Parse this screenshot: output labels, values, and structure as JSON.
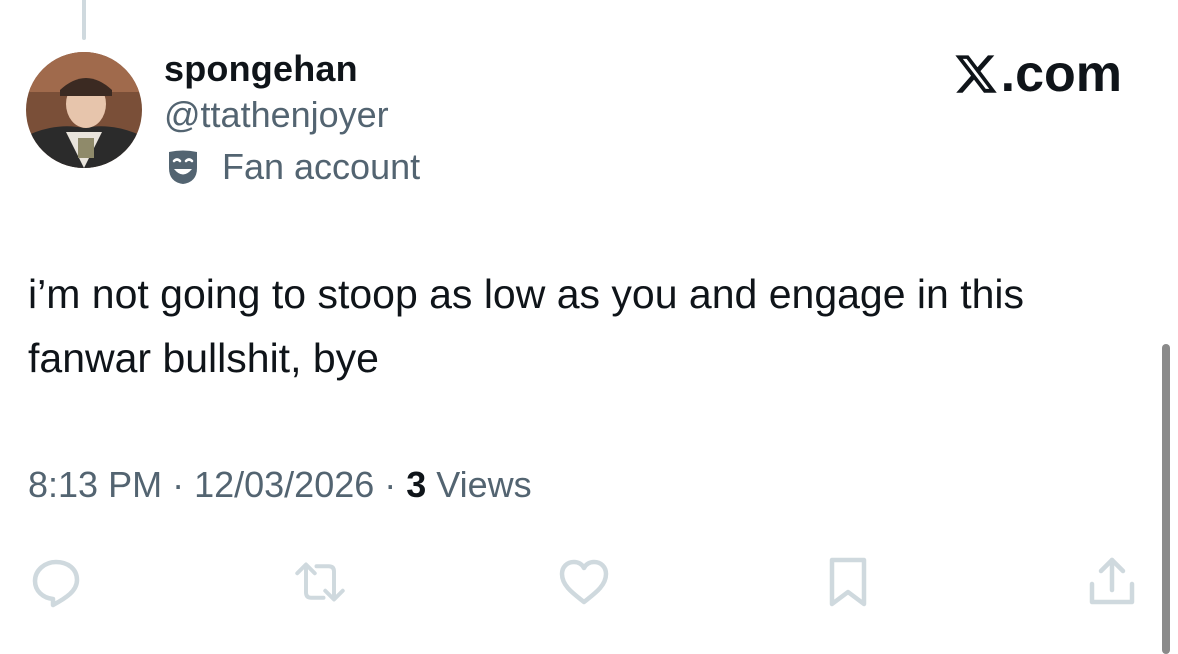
{
  "user": {
    "display_name": "spongehan",
    "handle": "@ttathenjoyer",
    "affiliation_label": "Fan account",
    "affiliation_icon": "theater-mask-icon",
    "avatar_icon": "avatar-photo"
  },
  "brand": {
    "text": ".com",
    "icon": "x-logo-icon"
  },
  "tweet": {
    "text": "i’m not going to stoop as low as you and engage in this fanwar bullshit, bye"
  },
  "meta": {
    "time": "8:13 PM",
    "separator_1": " · ",
    "date": "12/03/2026",
    "separator_2": " · ",
    "views_count": "3",
    "views_label": " Views"
  },
  "actions": [
    {
      "icon": "reply-icon"
    },
    {
      "icon": "retweet-icon"
    },
    {
      "icon": "like-icon"
    },
    {
      "icon": "bookmark-icon"
    },
    {
      "icon": "share-icon"
    }
  ],
  "colors": {
    "text_primary": "#0f1419",
    "text_secondary": "#536471",
    "icon_muted": "#cfd9de",
    "thread_line": "#cfd9de"
  }
}
